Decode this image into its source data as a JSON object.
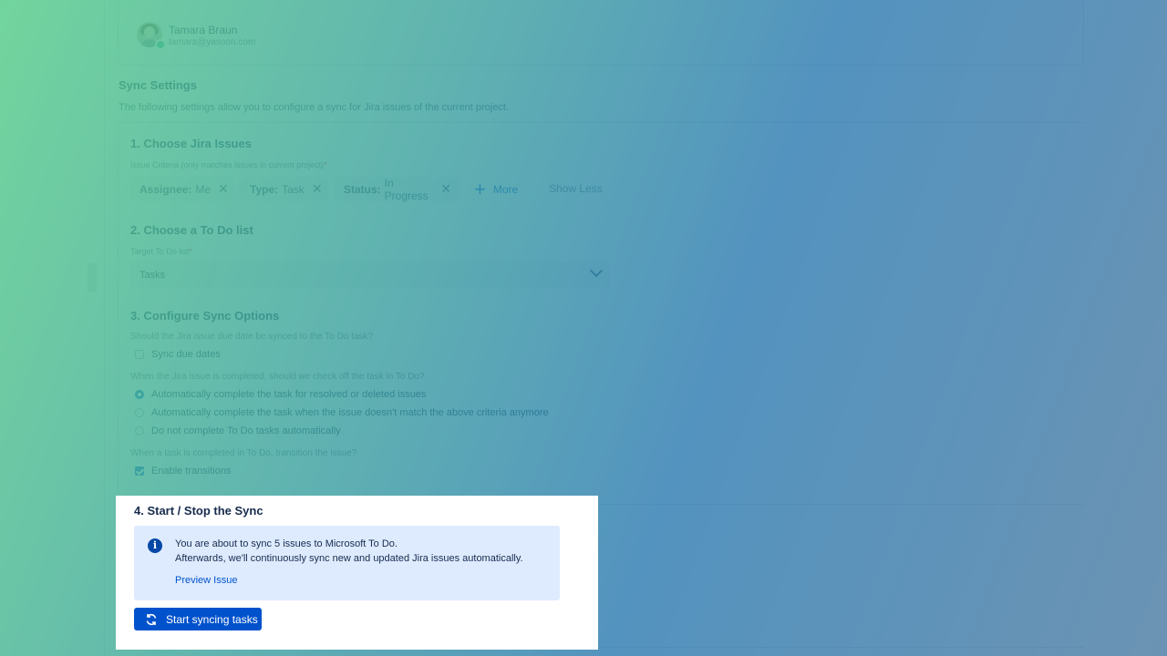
{
  "user": {
    "name": "Tamara Braun",
    "email": "tamara@yasoon.com"
  },
  "sync_settings": {
    "title": "Sync Settings",
    "description": "The following settings allow you to configure a sync for Jira issues of the current project."
  },
  "step1": {
    "title": "1. Choose Jira Issues",
    "criteria_label": "Issue Criteria (only matches issues in current project)",
    "required_mark": "*",
    "chips": [
      {
        "key": "Assignee:",
        "value": "Me"
      },
      {
        "key": "Type:",
        "value": "Task"
      },
      {
        "key": "Status:",
        "value": "In Progress"
      }
    ],
    "remove_glyph": "✕",
    "more_label": "More",
    "show_less_label": "Show Less"
  },
  "step2": {
    "title": "2. Choose a To Do list",
    "target_label": "Target To Do list",
    "required_mark": "*",
    "selected_list": "Tasks"
  },
  "step3": {
    "title": "3. Configure Sync Options",
    "due_date_question": "Should the Jira issue due date be synced to the To Do task?",
    "sync_due_dates_label": "Sync due dates",
    "sync_due_dates_checked": false,
    "complete_question": "When the Jira issue is completed, should we check off the task in To Do?",
    "complete_options": [
      {
        "label": "Automatically complete the task for resolved or deleted issues",
        "selected": true
      },
      {
        "label": "Automatically complete the task when the issue doesn't match the above criteria anymore",
        "selected": false
      },
      {
        "label": "Do not complete To Do tasks automatically",
        "selected": false
      }
    ],
    "transition_question": "When a task is completed in To Do, transition the issue?",
    "enable_transitions_label": "Enable transitions",
    "enable_transitions_checked": true
  },
  "step4": {
    "title": "4. Start / Stop the Sync",
    "info_icon": "i",
    "info_line1": "You are about to sync 5 issues to Microsoft To Do.",
    "info_line2": "Afterwards, we'll continuously sync new and updated Jira issues automatically.",
    "preview_link": "Preview Issue",
    "start_button": "Start syncing tasks"
  },
  "colors": {
    "accent": "#0052cc",
    "info_bg": "#deebff",
    "overlay_green": "#5acd8c",
    "overlay_blue": "#2878af"
  }
}
